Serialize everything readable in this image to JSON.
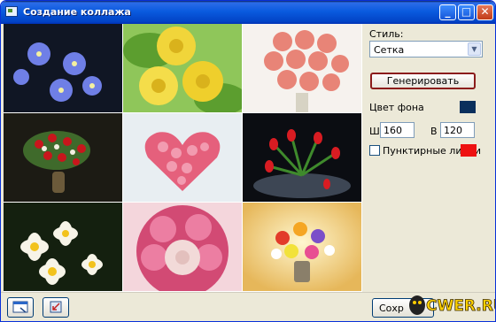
{
  "window": {
    "title": "Создание коллажа",
    "controls": [
      "minimize-icon",
      "maximize-icon",
      "close-icon"
    ]
  },
  "collage": {
    "grid": "3x3",
    "tiles": [
      "forget-me-not-flowers",
      "yellow-roses",
      "pink-roses-bouquet",
      "red-roses-vase-dark",
      "pink-rose-heart",
      "red-tulips-on-table",
      "frangipani-flowers",
      "pink-roses-bowl",
      "colorful-bouquet"
    ]
  },
  "panel": {
    "style_label": "Стиль:",
    "style_value": "Сетка",
    "generate_label": "Генерировать",
    "bg_color_label": "Цвет фона",
    "bg_color": "#0a2f5c",
    "width_label": "Ш",
    "width_value": "160",
    "height_label": "В",
    "height_value": "120",
    "dashed_label": "Пунктирные линии",
    "dashed_checked": false,
    "dashed_color": "#ee1111"
  },
  "bottom": {
    "save_label": "Сохр"
  },
  "watermark": {
    "text": "CWER.RU"
  }
}
